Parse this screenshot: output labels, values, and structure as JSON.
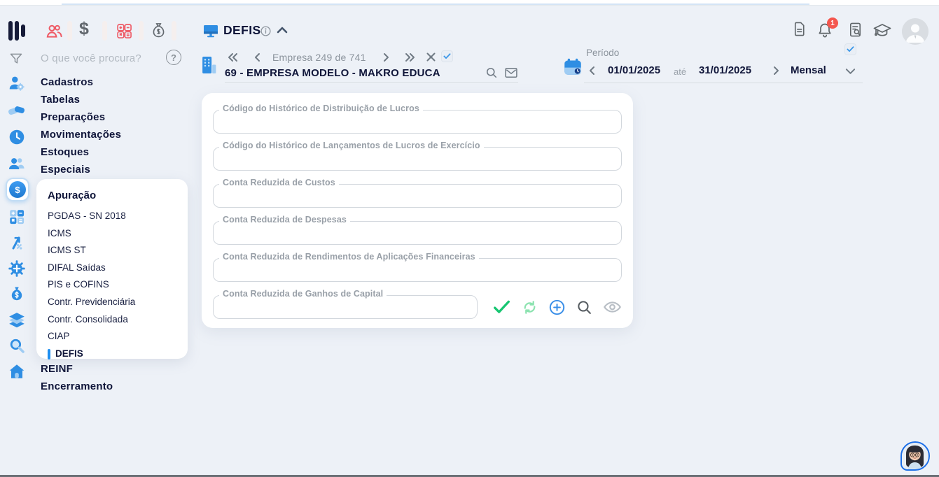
{
  "topbar": {
    "notification_badge": "1",
    "icon_names": [
      "clients-icon",
      "dollar-icon",
      "calculator-icon",
      "money-bag-icon",
      "documents-icon",
      "notifications-icon",
      "audit-icon",
      "training-icon",
      "user-avatar"
    ]
  },
  "sidebar": {
    "search_placeholder": "O que você procura?",
    "items": [
      "Cadastros",
      "Tabelas",
      "Preparações",
      "Movimentações",
      "Estoques",
      "Especiais"
    ],
    "apuracao": {
      "title": "Apuração",
      "items": [
        "PGDAS - SN 2018",
        "ICMS",
        "ICMS ST",
        "DIFAL Saídas",
        "PIS e COFINS",
        "Contr. Previdenciária",
        "Contr. Consolidada",
        "CIAP",
        "DEFIS"
      ],
      "selected": "DEFIS"
    },
    "items_bottom": [
      "REINF",
      "Encerramento"
    ]
  },
  "header": {
    "title": "DEFIS",
    "company_nav": {
      "counter": "Empresa 249 de 741",
      "company_name": "69 - EMPRESA MODELO - MAKRO EDUCA"
    },
    "period": {
      "label": "Período",
      "start_date": "01/01/2025",
      "until": "até",
      "end_date": "31/01/2025",
      "mode": "Mensal"
    }
  },
  "form": {
    "fields": [
      {
        "label": "Código do Histórico de Distribuição de Lucros",
        "value": ""
      },
      {
        "label": "Código do Histórico de Lançamentos de Lucros de Exercício",
        "value": ""
      },
      {
        "label": "Conta Reduzida de Custos",
        "value": ""
      },
      {
        "label": "Conta Reduzida de Despesas",
        "value": ""
      },
      {
        "label": "Conta Reduzida de Rendimentos de Aplicações Financeiras",
        "value": ""
      },
      {
        "label": "Conta Reduzida de Ganhos de Capital",
        "value": ""
      }
    ],
    "actions": [
      "confirm",
      "refresh",
      "add",
      "search",
      "view"
    ]
  },
  "glyphs": {
    "dollar": "$",
    "question": "?"
  },
  "colors": {
    "accent_blue": "#2f8ee3",
    "navy": "#10163a",
    "red": "#ee5b66",
    "green": "#17c671",
    "background": "#edf1f7"
  }
}
